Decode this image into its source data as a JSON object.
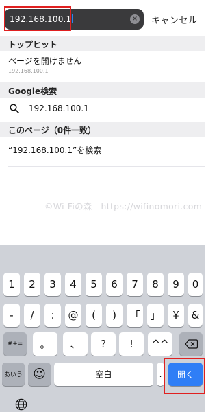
{
  "search": {
    "value": "192.168.100.1",
    "cancel_label": "キャンセル"
  },
  "top_hit": {
    "header": "トップヒット",
    "title": "ページを開けません",
    "subtitle": "192.168.100.1"
  },
  "google": {
    "header": "Google検索",
    "suggestion": "192.168.100.1"
  },
  "on_page": {
    "header": "このページ（0件一致）",
    "find_text": "“192.168.100.1”を検索"
  },
  "watermark": "©Wi-Fiの森　https://wifinomori.com",
  "keyboard": {
    "row1": [
      "1",
      "2",
      "3",
      "4",
      "5",
      "6",
      "7",
      "8",
      "9",
      "0"
    ],
    "row2": [
      "-",
      "/",
      ":",
      "@",
      "(",
      ")",
      "「",
      "」",
      "¥",
      "&"
    ],
    "row3_mode": "#+=",
    "row3": [
      "。",
      "、",
      "?",
      "!",
      "^^"
    ],
    "row4_kana": "あいう",
    "row4_emoji": "☺",
    "space_label": "空白",
    "dot_label": ".",
    "go_label": "開く"
  }
}
